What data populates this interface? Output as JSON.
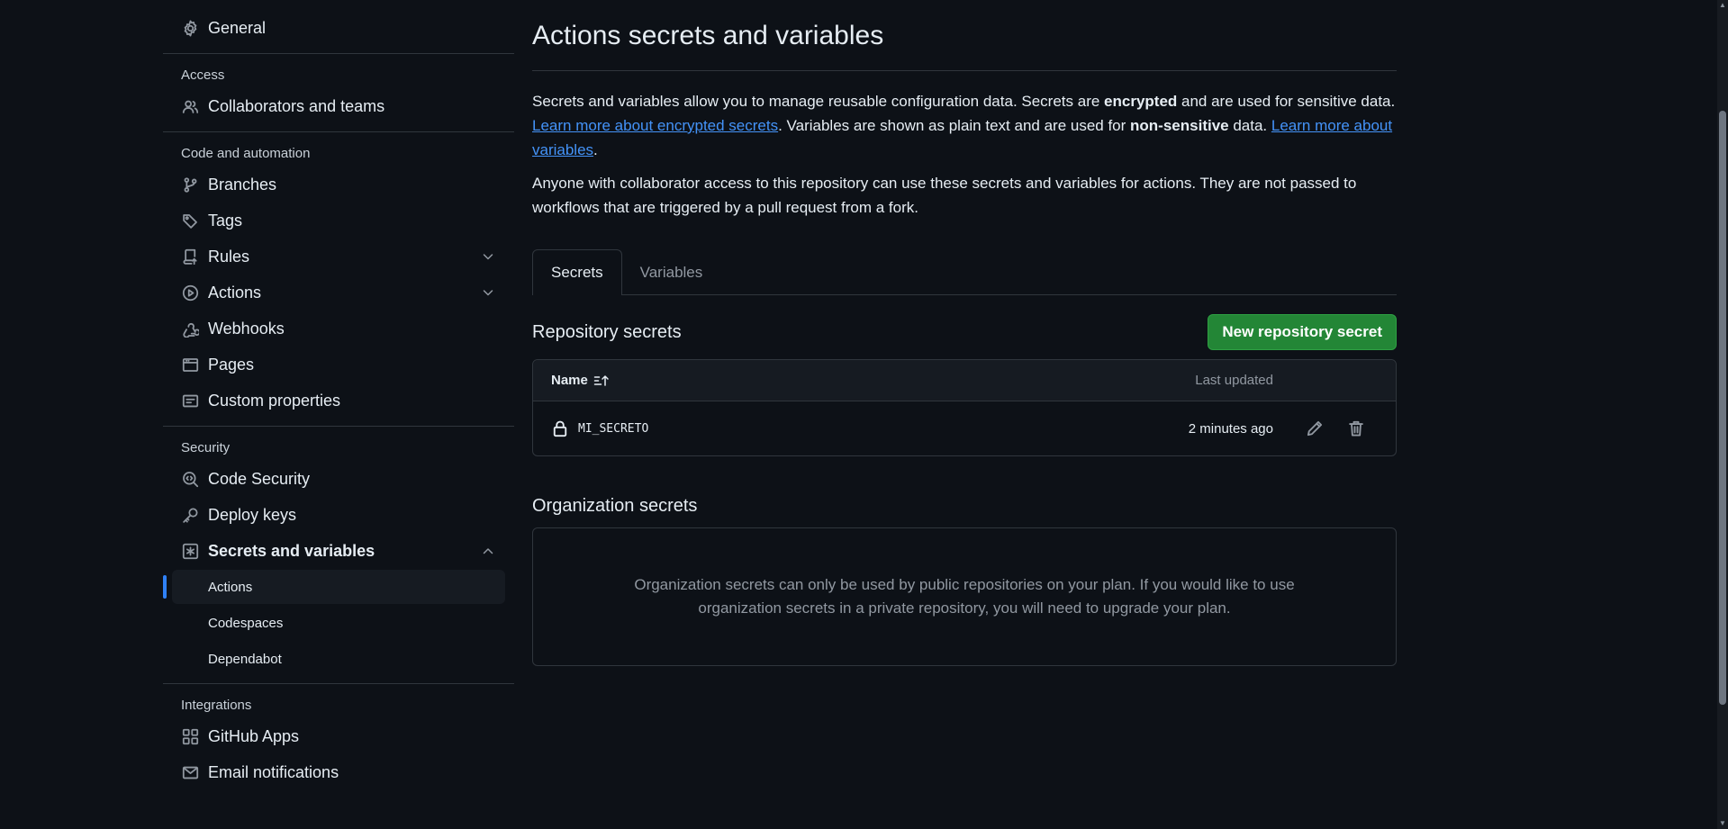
{
  "sidebar": {
    "general": "General",
    "sections": {
      "access": "Access",
      "code_automation": "Code and automation",
      "security": "Security",
      "integrations": "Integrations"
    },
    "items": {
      "collaborators": "Collaborators and teams",
      "branches": "Branches",
      "tags": "Tags",
      "rules": "Rules",
      "actions": "Actions",
      "webhooks": "Webhooks",
      "pages": "Pages",
      "custom_properties": "Custom properties",
      "code_security": "Code Security",
      "deploy_keys": "Deploy keys",
      "secrets_variables": "Secrets and variables",
      "github_apps": "GitHub Apps",
      "email_notifications": "Email notifications"
    },
    "sub_items": {
      "actions": "Actions",
      "codespaces": "Codespaces",
      "dependabot": "Dependabot"
    }
  },
  "main": {
    "title": "Actions secrets and variables",
    "intro": {
      "p1_a": "Secrets and variables allow you to manage reusable configuration data. Secrets are ",
      "p1_bold1": "encrypted",
      "p1_b": " and are used for sensitive data. ",
      "link_secrets": "Learn more about encrypted secrets",
      "p1_c": ". Variables are shown as plain text and are used for ",
      "p1_bold2": "non-sensitive",
      "p1_d": " data. ",
      "link_variables": "Learn more about variables",
      "p1_e": ".",
      "p2": "Anyone with collaborator access to this repository can use these secrets and variables for actions. They are not passed to workflows that are triggered by a pull request from a fork."
    },
    "tabs": {
      "secrets": "Secrets",
      "variables": "Variables"
    },
    "repo_secrets": {
      "heading": "Repository secrets",
      "new_button": "New repository secret",
      "col_name": "Name",
      "col_updated": "Last updated",
      "rows": [
        {
          "name": "MI_SECRETO",
          "updated": "2 minutes ago"
        }
      ]
    },
    "org_secrets": {
      "heading": "Organization secrets",
      "message": "Organization secrets can only be used by public repositories on your plan. If you would like to use organization secrets in a private repository, you will need to upgrade your plan."
    }
  },
  "colors": {
    "background": "#0d1117",
    "accent_blue": "#2f81f7",
    "link": "#4493f8",
    "primary_button": "#238636",
    "border": "#30363d"
  }
}
